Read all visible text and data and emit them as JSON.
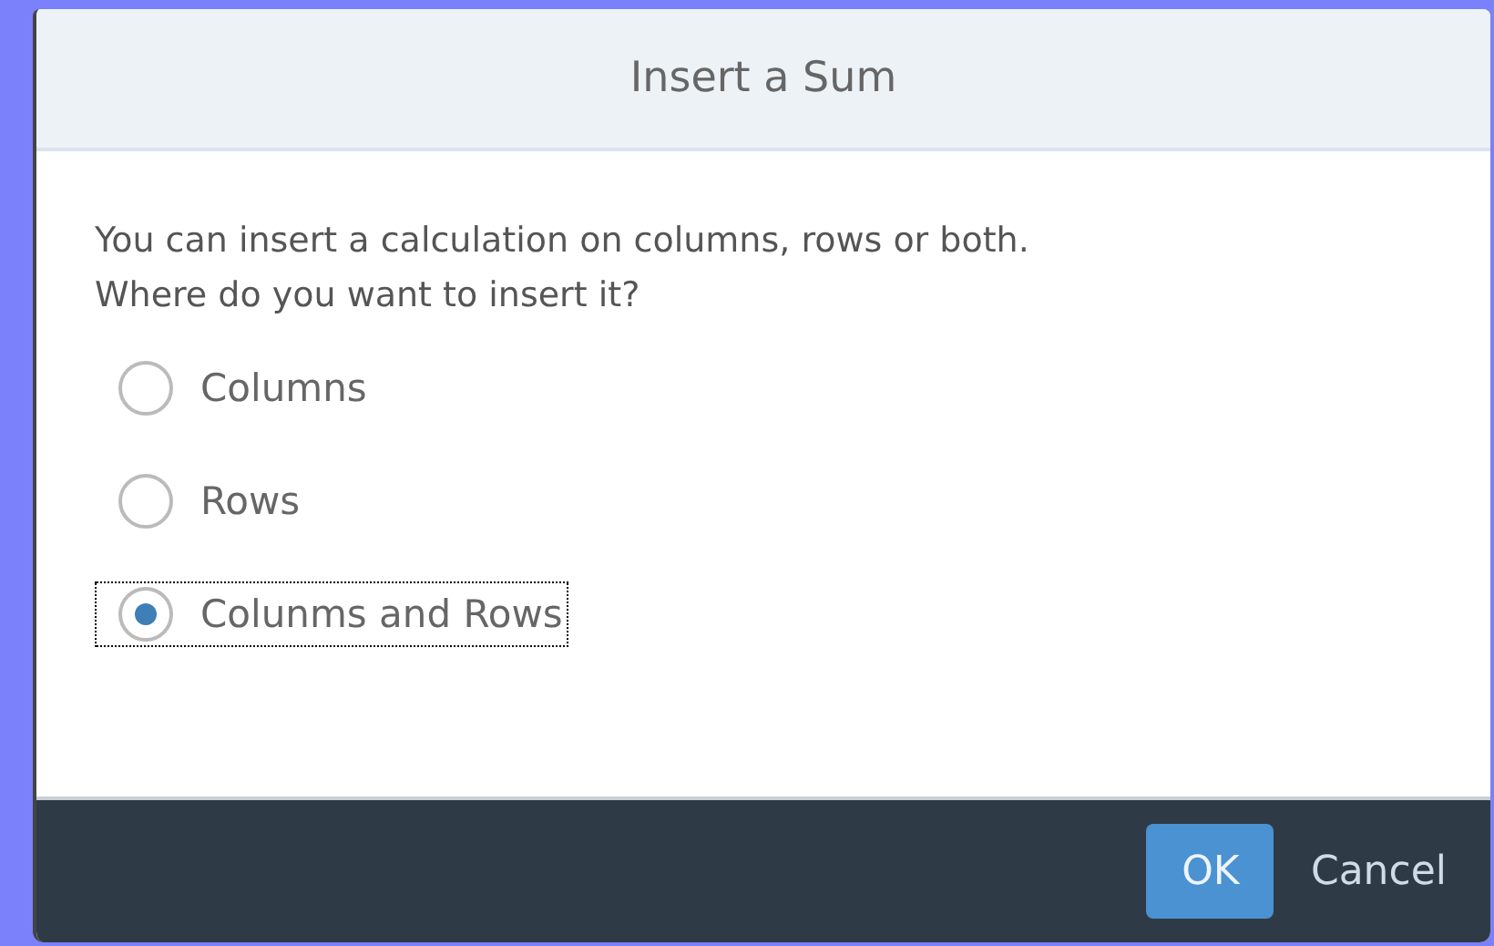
{
  "dialog": {
    "title": "Insert a Sum",
    "message": "You can insert a calculation on columns, rows or both.\nWhere do you want to insert it?",
    "options": [
      {
        "label": "Columns",
        "selected": false
      },
      {
        "label": "Rows",
        "selected": false
      },
      {
        "label": "Colunms and Rows",
        "selected": true
      }
    ],
    "buttons": [
      {
        "label": "OK",
        "kind": "primary"
      },
      {
        "label": "Cancel",
        "kind": "secondary"
      }
    ]
  }
}
